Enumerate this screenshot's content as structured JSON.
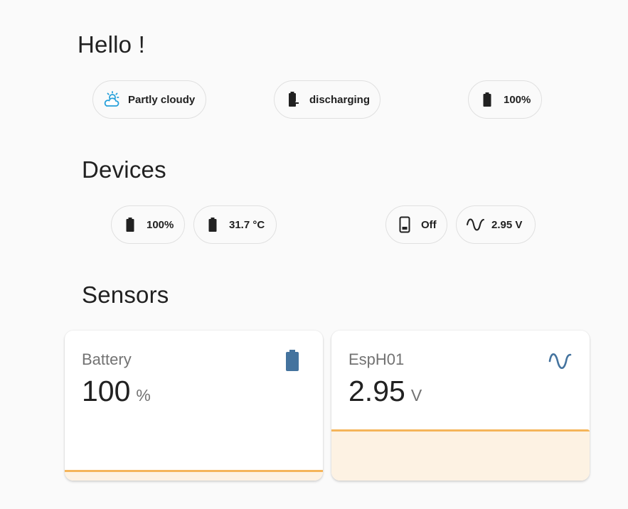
{
  "greeting": {
    "title": "Hello !"
  },
  "header_chips": [
    {
      "icon": "weather-partly-cloudy-icon",
      "label": "Partly cloudy"
    },
    {
      "icon": "battery-discharging-icon",
      "label": "discharging"
    },
    {
      "icon": "battery-icon",
      "label": "100%"
    }
  ],
  "devices": {
    "title": "Devices",
    "chips": [
      {
        "icon": "battery-icon",
        "label": "100%"
      },
      {
        "icon": "battery-icon",
        "label": "31.7 °C"
      },
      {
        "icon": "phone-icon",
        "label": "Off"
      },
      {
        "icon": "sine-wave-icon",
        "label": "2.95 V"
      }
    ]
  },
  "sensors": {
    "title": "Sensors",
    "cards": [
      {
        "name": "Battery",
        "value": "100",
        "unit": "%",
        "icon": "battery-icon",
        "icon_color": "#44739e"
      },
      {
        "name": "EspH01",
        "value": "2.95",
        "unit": "V",
        "icon": "sine-wave-icon",
        "icon_color": "#44739e"
      }
    ]
  },
  "colors": {
    "accent_graph": "#f5b55a",
    "graph_fill": "#fdf2e3",
    "weather_icon": "#26a0da"
  }
}
